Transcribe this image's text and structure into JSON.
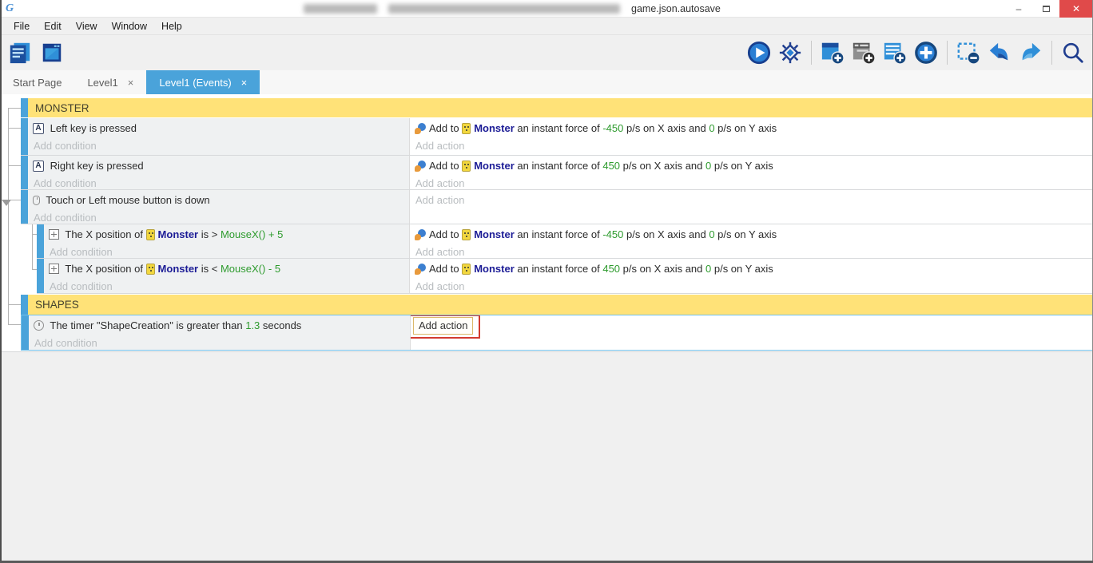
{
  "window": {
    "title_visible": "game.json.autosave",
    "controls": {
      "minimize": "–",
      "close": "✕"
    }
  },
  "menu": {
    "items": [
      "File",
      "Edit",
      "View",
      "Window",
      "Help"
    ]
  },
  "toolbar": {
    "left_icons": [
      "project-manager",
      "start-page"
    ],
    "right_icons": [
      "play",
      "debug",
      "add-event",
      "add-subevent",
      "add-comment",
      "add-circle",
      "remove-selection",
      "undo",
      "redo",
      "search"
    ]
  },
  "tabs": {
    "close_glyph": "×",
    "items": [
      {
        "label": "Start Page",
        "closable": false,
        "active": false
      },
      {
        "label": "Level1",
        "closable": true,
        "active": false
      },
      {
        "label": "Level1 (Events)",
        "closable": true,
        "active": true
      }
    ]
  },
  "labels": {
    "add_condition": "Add condition",
    "add_action": "Add action"
  },
  "colors": {
    "accent_blue": "#4aa3da",
    "comment_yellow": "#ffe278",
    "expression_green": "#2e9b2e",
    "object_navy": "#1c1c96",
    "placeholder_gray": "#b9bdc0",
    "selection_border": "#72c0e9",
    "annotation_red": "#d23b2e",
    "close_button_red": "#e04a4a"
  },
  "events": {
    "comment1": "MONSTER",
    "comment2": "SHAPES",
    "r1": {
      "cond": [
        {
          "icon": "keyboard",
          "glyph": "A"
        },
        {
          "t": " Left key is pressed"
        }
      ],
      "act": [
        {
          "icon": "force"
        },
        {
          "t": "Add to "
        },
        {
          "icon": "monster"
        },
        {
          "t": "Monster",
          "c": "obj"
        },
        {
          "t": " an instant force of "
        },
        {
          "t": "-450",
          "c": "g"
        },
        {
          "t": " p/s on X axis and "
        },
        {
          "t": "0",
          "c": "g"
        },
        {
          "t": " p/s on Y axis"
        }
      ]
    },
    "r2": {
      "cond": [
        {
          "icon": "keyboard",
          "glyph": "A"
        },
        {
          "t": " Right key is pressed"
        }
      ],
      "act": [
        {
          "icon": "force"
        },
        {
          "t": "Add to "
        },
        {
          "icon": "monster"
        },
        {
          "t": "Monster",
          "c": "obj"
        },
        {
          "t": " an instant force of "
        },
        {
          "t": "450",
          "c": "g"
        },
        {
          "t": " p/s on X axis and "
        },
        {
          "t": "0",
          "c": "g"
        },
        {
          "t": " p/s on Y axis"
        }
      ]
    },
    "r3": {
      "cond": [
        {
          "icon": "mouse"
        },
        {
          "t": " Touch or Left mouse button is down"
        }
      ]
    },
    "r4": {
      "cond": [
        {
          "icon": "position"
        },
        {
          "t": " The X position of "
        },
        {
          "icon": "monster"
        },
        {
          "t": "Monster",
          "c": "obj"
        },
        {
          "t": " is > "
        },
        {
          "t": "MouseX() + 5",
          "c": "g"
        }
      ],
      "act": [
        {
          "icon": "force"
        },
        {
          "t": "Add to "
        },
        {
          "icon": "monster"
        },
        {
          "t": "Monster",
          "c": "obj"
        },
        {
          "t": " an instant force of "
        },
        {
          "t": "-450",
          "c": "g"
        },
        {
          "t": " p/s on X axis and "
        },
        {
          "t": "0",
          "c": "g"
        },
        {
          "t": " p/s on Y axis"
        }
      ]
    },
    "r5": {
      "cond": [
        {
          "icon": "position"
        },
        {
          "t": " The X position of "
        },
        {
          "icon": "monster"
        },
        {
          "t": "Monster",
          "c": "obj"
        },
        {
          "t": " is < "
        },
        {
          "t": "MouseX() - 5",
          "c": "g"
        }
      ],
      "act": [
        {
          "icon": "force"
        },
        {
          "t": "Add to "
        },
        {
          "icon": "monster"
        },
        {
          "t": "Monster",
          "c": "obj"
        },
        {
          "t": " an instant force of "
        },
        {
          "t": "450",
          "c": "g"
        },
        {
          "t": " p/s on X axis and "
        },
        {
          "t": "0",
          "c": "g"
        },
        {
          "t": " p/s on Y axis"
        }
      ]
    },
    "r6": {
      "cond": [
        {
          "icon": "timer"
        },
        {
          "t": " The timer \"ShapeCreation\" is greater than "
        },
        {
          "t": "1.3",
          "c": "g"
        },
        {
          "t": " seconds"
        }
      ]
    }
  }
}
